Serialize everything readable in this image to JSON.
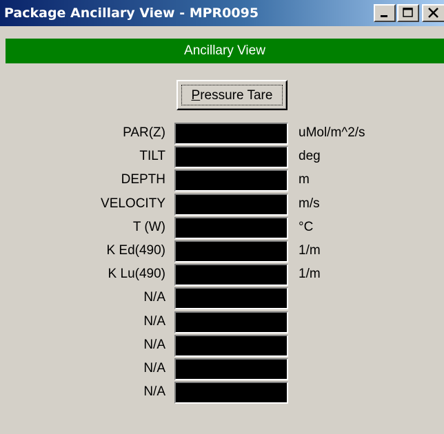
{
  "window": {
    "title": "Package Ancillary View - MPR0095",
    "controls": [
      "minimize-icon",
      "maximize-icon",
      "close-icon"
    ]
  },
  "header": {
    "title": "Ancillary View"
  },
  "actions": {
    "tare_label_prefix": "P",
    "tare_label_rest": "ressure Tare"
  },
  "colors": {
    "title_bar_start": "#0a246a",
    "title_bar_end": "#a6caf0",
    "header_band": "#008000",
    "window_bg": "#d4d0c8",
    "value_field_bg": "#000000"
  },
  "rows": [
    {
      "label": "PAR(Z)",
      "value": "",
      "unit": "uMol/m^2/s"
    },
    {
      "label": "TILT",
      "value": "",
      "unit": "deg"
    },
    {
      "label": "DEPTH",
      "value": "",
      "unit": "m"
    },
    {
      "label": "VELOCITY",
      "value": "",
      "unit": "m/s"
    },
    {
      "label": "T (W)",
      "value": "",
      "unit": "°C"
    },
    {
      "label": "K Ed(490)",
      "value": "",
      "unit": "1/m"
    },
    {
      "label": "K Lu(490)",
      "value": "",
      "unit": "1/m"
    },
    {
      "label": "N/A",
      "value": "",
      "unit": ""
    },
    {
      "label": "N/A",
      "value": "",
      "unit": ""
    },
    {
      "label": "N/A",
      "value": "",
      "unit": ""
    },
    {
      "label": "N/A",
      "value": "",
      "unit": ""
    },
    {
      "label": "N/A",
      "value": "",
      "unit": ""
    }
  ]
}
